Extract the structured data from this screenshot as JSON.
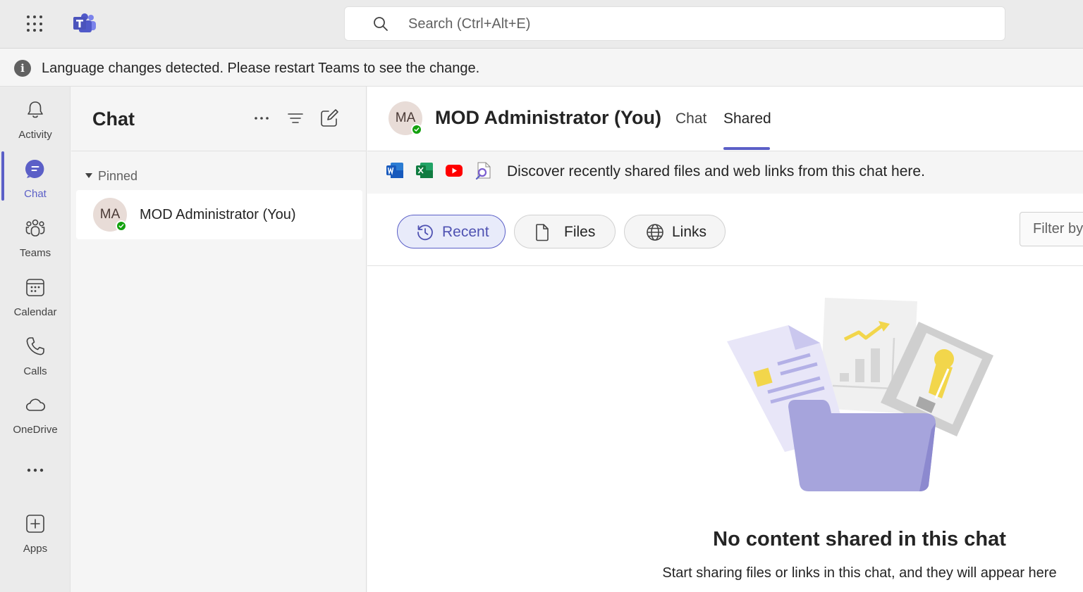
{
  "app": {
    "search_placeholder": "Search (Ctrl+Alt+E)"
  },
  "banner": {
    "message": "Language changes detected. Please restart Teams to see the change."
  },
  "rail": {
    "items": [
      {
        "label": "Activity",
        "icon": "bell-icon"
      },
      {
        "label": "Chat",
        "icon": "chat-icon",
        "active": true
      },
      {
        "label": "Teams",
        "icon": "teams-icon"
      },
      {
        "label": "Calendar",
        "icon": "calendar-icon"
      },
      {
        "label": "Calls",
        "icon": "phone-icon"
      },
      {
        "label": "OneDrive",
        "icon": "cloud-icon"
      },
      {
        "label": "",
        "icon": "more-icon"
      },
      {
        "label": "Apps",
        "icon": "add-app-icon"
      }
    ]
  },
  "chatpane": {
    "title": "Chat",
    "pinned_label": "Pinned",
    "items": [
      {
        "initials": "MA",
        "name": "MOD Administrator (You)",
        "presence": "available"
      }
    ]
  },
  "main": {
    "avatar_initials": "MA",
    "title": "MOD Administrator (You)",
    "tabs": [
      {
        "label": "Chat",
        "active": false
      },
      {
        "label": "Shared",
        "active": true
      }
    ],
    "discover_text": "Discover recently shared files and web links from this chat here.",
    "pills": [
      {
        "label": "Recent",
        "icon": "history-icon",
        "active": true
      },
      {
        "label": "Files",
        "icon": "file-icon",
        "active": false
      },
      {
        "label": "Links",
        "icon": "globe-icon",
        "active": false
      }
    ],
    "filter_placeholder": "Filter by",
    "empty_title": "No content shared in this chat",
    "empty_subtitle": "Start sharing files or links in this chat, and they will appear here"
  },
  "colors": {
    "brand": "#5b5fc7",
    "presence_available": "#13a10e"
  }
}
